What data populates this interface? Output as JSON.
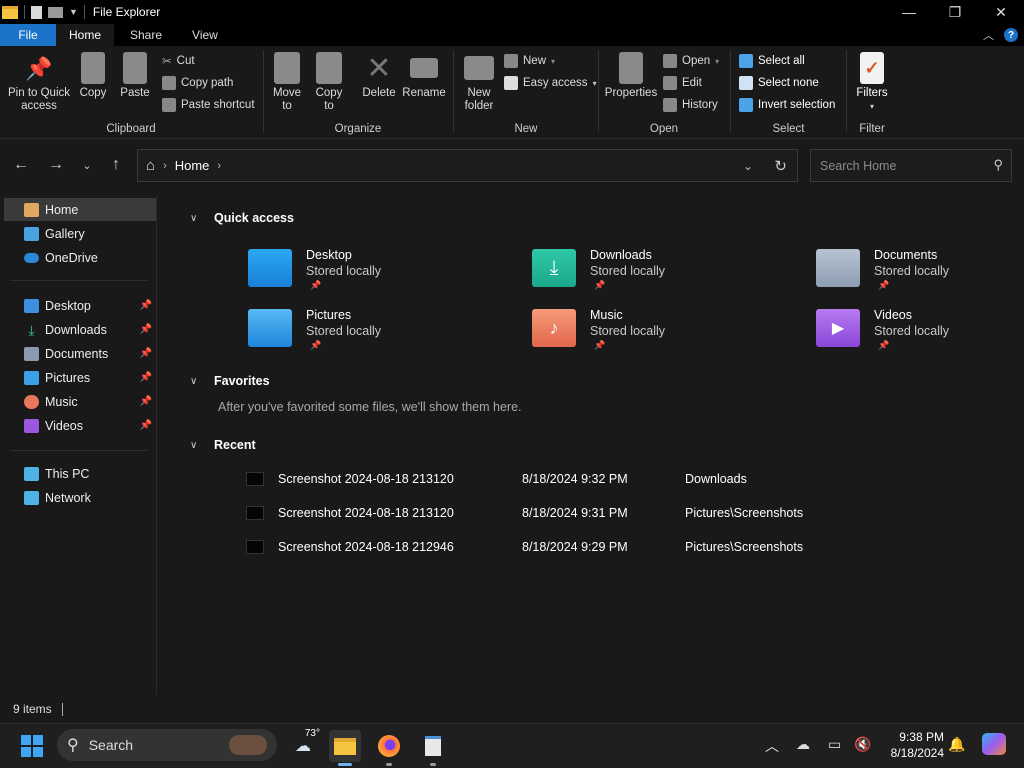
{
  "window": {
    "title": "File Explorer"
  },
  "tabs": [
    {
      "label": "File"
    },
    {
      "label": "Home"
    },
    {
      "label": "Share"
    },
    {
      "label": "View"
    }
  ],
  "help_label": "?",
  "ribbon": {
    "clipboard": {
      "name": "Clipboard",
      "pin": "Pin to Quick access",
      "copy": "Copy",
      "paste": "Paste",
      "cut": "Cut",
      "copy_path": "Copy path",
      "paste_shortcut": "Paste shortcut"
    },
    "organize": {
      "name": "Organize",
      "move_to": "Move to",
      "copy_to": "Copy to",
      "delete": "Delete",
      "rename": "Rename"
    },
    "new": {
      "name": "New",
      "new_folder": "New folder",
      "new_item": "New",
      "easy_access": "Easy access"
    },
    "open": {
      "name": "Open",
      "properties": "Properties",
      "open": "Open",
      "edit": "Edit",
      "history": "History"
    },
    "select": {
      "name": "Select",
      "select_all": "Select all",
      "select_none": "Select none",
      "invert": "Invert selection"
    },
    "filter": {
      "name": "Filter",
      "filters": "Filters"
    }
  },
  "address": {
    "crumb": "Home"
  },
  "search": {
    "placeholder": "Search Home"
  },
  "sidebar": {
    "top": [
      {
        "label": "Home"
      },
      {
        "label": "Gallery"
      },
      {
        "label": "OneDrive"
      }
    ],
    "pinned": [
      {
        "label": "Desktop"
      },
      {
        "label": "Downloads"
      },
      {
        "label": "Documents"
      },
      {
        "label": "Pictures"
      },
      {
        "label": "Music"
      },
      {
        "label": "Videos"
      }
    ],
    "bottom": [
      {
        "label": "This PC"
      },
      {
        "label": "Network"
      }
    ]
  },
  "sections": {
    "quick_access": "Quick access",
    "favorites": "Favorites",
    "favorites_empty": "After you've favorited some files, we'll show them here.",
    "recent": "Recent"
  },
  "quick_access": [
    {
      "name": "Desktop",
      "sub": "Stored locally"
    },
    {
      "name": "Downloads",
      "sub": "Stored locally"
    },
    {
      "name": "Documents",
      "sub": "Stored locally"
    },
    {
      "name": "Pictures",
      "sub": "Stored locally"
    },
    {
      "name": "Music",
      "sub": "Stored locally"
    },
    {
      "name": "Videos",
      "sub": "Stored locally"
    }
  ],
  "recent": [
    {
      "name": "Screenshot 2024-08-18 213120",
      "date": "8/18/2024 9:32 PM",
      "location": "Downloads"
    },
    {
      "name": "Screenshot 2024-08-18 213120",
      "date": "8/18/2024 9:31 PM",
      "location": "Pictures\\Screenshots"
    },
    {
      "name": "Screenshot 2024-08-18 212946",
      "date": "8/18/2024 9:29 PM",
      "location": "Pictures\\Screenshots"
    }
  ],
  "status": {
    "items": "9 items"
  },
  "taskbar": {
    "search": "Search",
    "weather": "73°",
    "time": "9:38 PM",
    "date": "8/18/2024"
  },
  "colors": {
    "accent": "#1a73c9",
    "bg": "#191919",
    "selected": "#3a3a3a"
  }
}
